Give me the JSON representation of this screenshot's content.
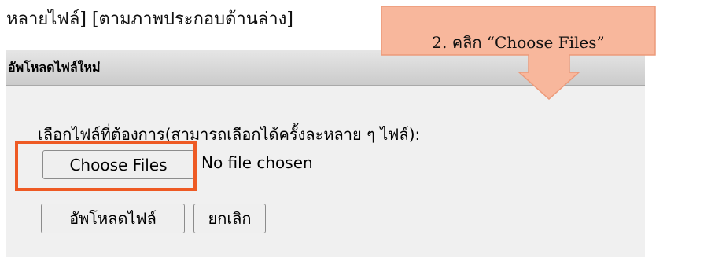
{
  "caption": {
    "text": "หลายไฟล์] [ตามภาพประกอบด้านล่าง]"
  },
  "dialog": {
    "title": "อัพโหลดไฟล์ใหม่",
    "prompt": "เลือกไฟล์ที่ต้องการ(สามารถเลือกได้ครั้งละหลาย ๆ ไฟล์):",
    "file_input": {
      "button_label": "Choose Files",
      "status": "No file chosen"
    },
    "buttons": {
      "upload": "อัพโหลดไฟล์",
      "cancel": "ยกเลิก"
    }
  },
  "callout": {
    "text": "2. คลิก “Choose Files”"
  },
  "colors": {
    "highlight": "#ee5a24",
    "callout_fill": "#f8b79c",
    "callout_stroke": "#ec9a7a"
  }
}
